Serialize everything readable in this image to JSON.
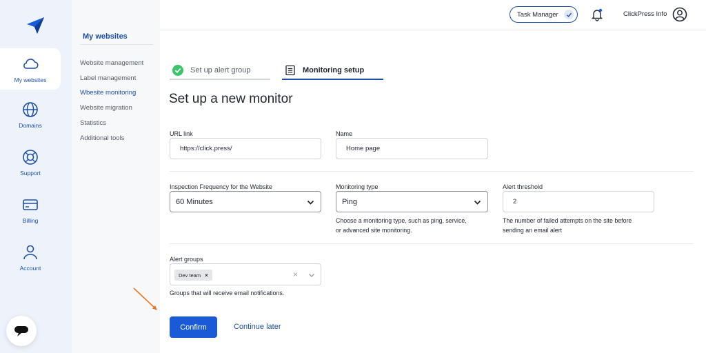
{
  "rail": {
    "items": [
      {
        "label": "My websites",
        "icon": "cloud-icon",
        "active": true
      },
      {
        "label": "Domains",
        "icon": "globe-icon"
      },
      {
        "label": "Support",
        "icon": "lifebuoy-icon"
      },
      {
        "label": "Billing",
        "icon": "credit-card-icon"
      },
      {
        "label": "Account",
        "icon": "user-icon"
      }
    ]
  },
  "subnav": {
    "title": "My websites",
    "items": [
      {
        "label": "Website management"
      },
      {
        "label": "Label management"
      },
      {
        "label": "Wbesite monitoring",
        "active": true
      },
      {
        "label": "Website migration"
      },
      {
        "label": "Statistics"
      },
      {
        "label": "Additional tools"
      }
    ]
  },
  "header": {
    "task_manager": "Task Manager",
    "user_name": "ClickPress Info"
  },
  "steps": [
    {
      "label": "Set up alert group",
      "status": "done"
    },
    {
      "label": "Monitoring setup",
      "status": "active"
    }
  ],
  "page_title": "Set up a new monitor",
  "form": {
    "url": {
      "label": "URL link",
      "value": "https://click.press/"
    },
    "name": {
      "label": "Name",
      "value": "Home page"
    },
    "frequency": {
      "label": "Inspection Frequency for the Website",
      "value": "60 Minutes"
    },
    "monitoring_type": {
      "label": "Monitoring type",
      "value": "Ping",
      "help_line1": "Choose a monitoring type, such as ping, service,",
      "help_line2": "or advanced site monitoring."
    },
    "alert_threshold": {
      "label": "Alert threshold",
      "value": "2",
      "help_line1": "The number of failed attempts on the site before",
      "help_line2": "sending an email alert"
    },
    "alert_groups": {
      "label": "Alert groups",
      "chip": "Dev team",
      "help": "Groups that will receive email notifications."
    }
  },
  "actions": {
    "confirm": "Confirm",
    "later": "Continue later"
  },
  "colors": {
    "accent": "#1b5ad6",
    "brand_blue": "#1b4fa8",
    "success": "#3cc46b",
    "annotation_arrow": "#e87722"
  }
}
